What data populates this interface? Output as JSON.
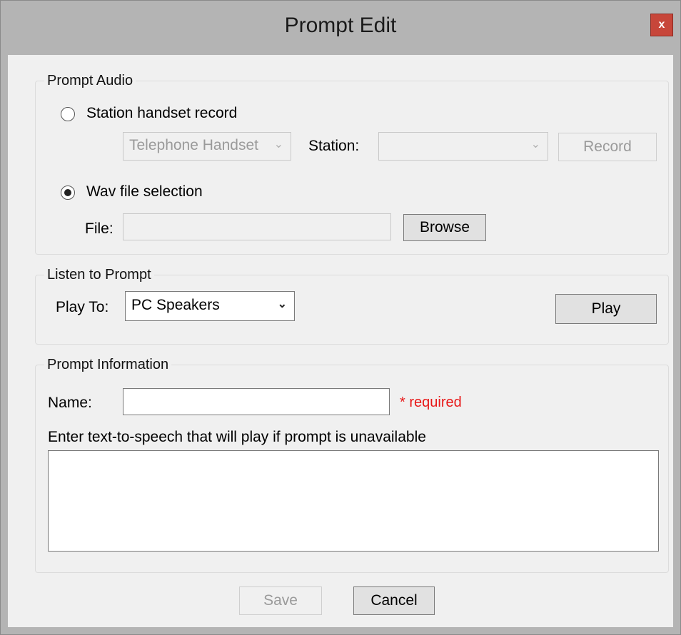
{
  "window": {
    "title": "Prompt Edit",
    "close_glyph": "x"
  },
  "prompt_audio": {
    "label": "Prompt Audio",
    "station_option": {
      "label": "Station handset record",
      "selected": false
    },
    "handset_combo": {
      "value": "Telephone Handset",
      "enabled": false
    },
    "station_label": "Station:",
    "station_combo": {
      "value": "",
      "enabled": false
    },
    "record_button": "Record",
    "wav_option": {
      "label": "Wav file selection",
      "selected": true
    },
    "file_label": "File:",
    "file_value": "",
    "browse_button": "Browse"
  },
  "listen": {
    "label": "Listen to Prompt",
    "play_to_label": "Play To:",
    "play_to_value": "PC Speakers",
    "play_button": "Play"
  },
  "prompt_info": {
    "label": "Prompt Information",
    "name_label": "Name:",
    "name_value": "",
    "required_text": "* required",
    "tts_label": "Enter text-to-speech that will play if prompt is unavailable",
    "tts_value": ""
  },
  "footer": {
    "save_button": "Save",
    "cancel_button": "Cancel"
  },
  "colors": {
    "title_bar": "#b4b4b4",
    "dialog_bg": "#f0f0f0",
    "close_button": "#c7463a",
    "required": "#e81818",
    "disabled_text": "#9a9a9a"
  },
  "icons": {
    "dropdown": "chevron-down-icon",
    "close": "close-icon",
    "radio": "radio-icon"
  }
}
